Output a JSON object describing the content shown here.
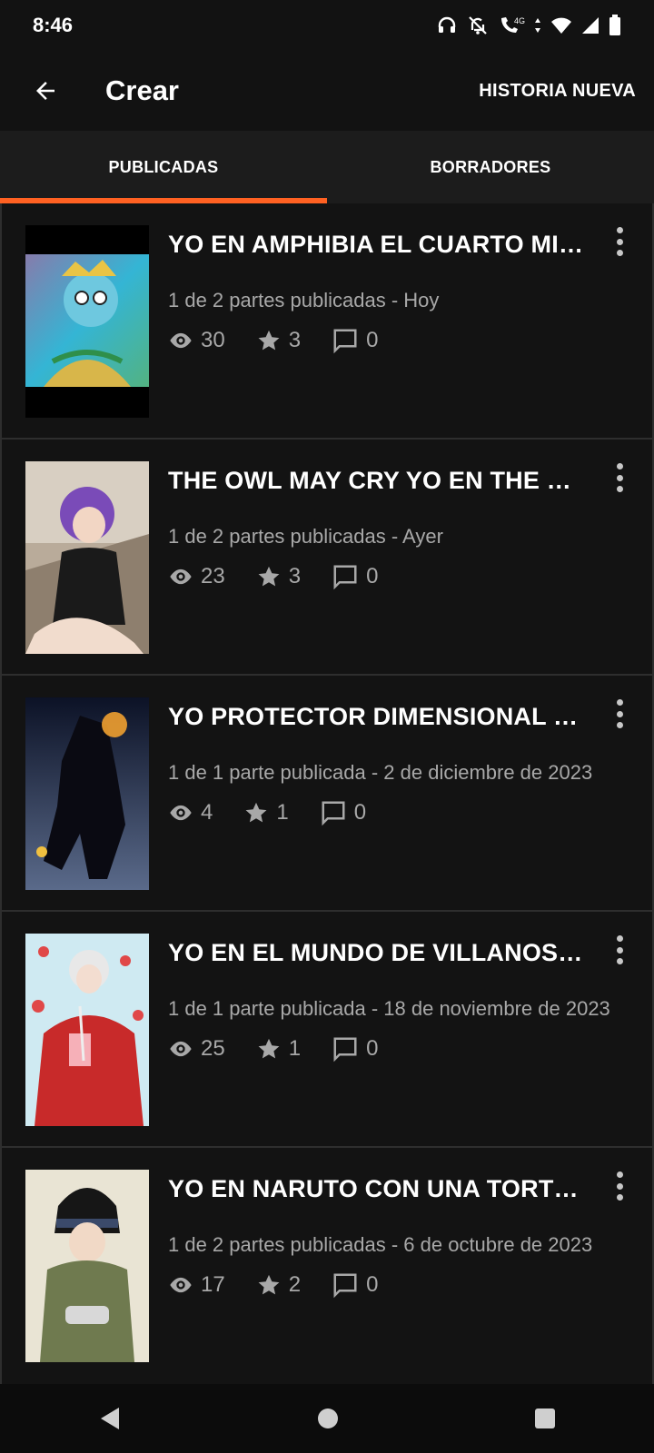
{
  "status": {
    "time": "8:46",
    "icons": [
      "headphones-icon",
      "bell-off-icon",
      "wifi-call-icon",
      "4g-icon",
      "wifi-icon",
      "signal-icon",
      "battery-icon"
    ]
  },
  "appbar": {
    "title": "Crear",
    "action": "HISTORIA NUEVA"
  },
  "tabs": [
    {
      "label": "PUBLICADAS",
      "active": true
    },
    {
      "label": "BORRADORES",
      "active": false
    }
  ],
  "accent": "#ff6122",
  "stories": [
    {
      "title": "YO EN AMPHIBIA EL CUARTO MIE...",
      "meta": "1 de 2 partes publicadas - Hoy",
      "views": "30",
      "votes": "3",
      "comments": "0"
    },
    {
      "title": "THE OWL MAY CRY YO EN THE OW...",
      "meta": "1 de 2 partes publicadas - Ayer",
      "views": "23",
      "votes": "3",
      "comments": "0"
    },
    {
      "title": "YO PROTECTOR DIMENSIONAL VS ...",
      "meta": "1 de 1 parte publicada - 2 de diciembre de 2023",
      "views": "4",
      "votes": "1",
      "comments": "0"
    },
    {
      "title": "YO EN EL MUNDO  DE VILLANOS C...",
      "meta": "1 de 1 parte publicada - 18 de noviembre de 2023",
      "views": "25",
      "votes": "1",
      "comments": "0"
    },
    {
      "title": "YO EN NARUTO CON UNA TORTUO...",
      "meta": "1 de 2 partes publicadas - 6 de octubre de 2023",
      "views": "17",
      "votes": "2",
      "comments": "0"
    }
  ]
}
